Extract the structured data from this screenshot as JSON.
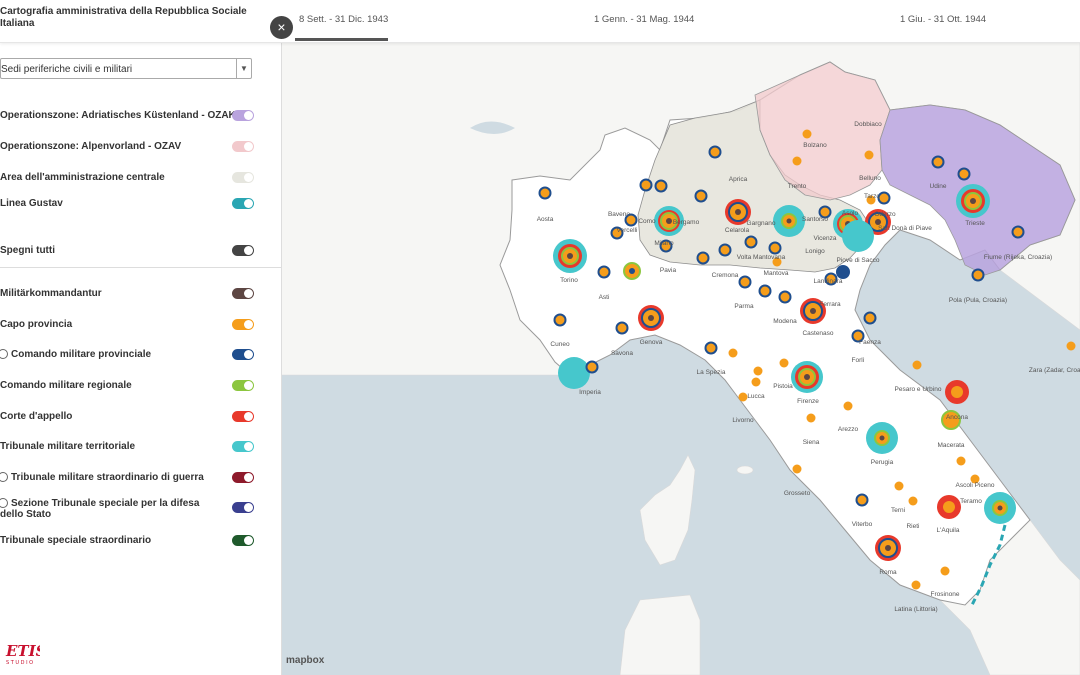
{
  "header": {
    "app_title": "Cartografia amministrativa della Repubblica Sociale Italiana",
    "tabs": [
      {
        "label": "8 Sett. - 31 Dic. 1943",
        "active": true
      },
      {
        "label": "1 Genn. - 31 Mag. 1944",
        "active": false
      },
      {
        "label": "1 Giu. - 31 Ott. 1944",
        "active": false
      }
    ]
  },
  "sidebar": {
    "select_value": "Sedi periferiche civili e militari",
    "close_icon": "close-icon",
    "area_layers": [
      {
        "label": "Operationszone: Adriatisches Küstenland - OZAK",
        "color": "#b9a3de",
        "on": true
      },
      {
        "label": "Operationszone: Alpenvorland - OZAV",
        "color": "#f2c9cc",
        "on": true
      },
      {
        "label": "Area dell'amministrazione centrale",
        "color": "#e6e6df",
        "on": true
      },
      {
        "label": "Linea Gustav",
        "color": "#2aa6b3",
        "on": true
      }
    ],
    "toggle_all_label": "Spegni tutti",
    "toggle_all_color": "#444444",
    "point_layers": [
      {
        "label": "Militärkommandantur",
        "color": "#5d4643",
        "radio": false
      },
      {
        "label": "Capo provincia",
        "color": "#f59d1b",
        "radio": false
      },
      {
        "label": "Comando militare provinciale",
        "color": "#1f4e8e",
        "radio": true
      },
      {
        "label": "Comando militare regionale",
        "color": "#8cc63f",
        "radio": false
      },
      {
        "label": "Corte d'appello",
        "color": "#e8392b",
        "radio": false
      },
      {
        "label": "Tribunale militare territoriale",
        "color": "#46c7cc",
        "radio": false
      },
      {
        "label": "Tribunale militare straordinario di guerra",
        "color": "#8e1a2b",
        "radio": true
      },
      {
        "label": "Sezione Tribunale speciale per la difesa dello Stato",
        "color": "#3a3f8f",
        "radio": true
      },
      {
        "label": "Tribunale speciale straordinario",
        "color": "#1f5a2c",
        "radio": false
      }
    ],
    "logo_text": "ETIS",
    "logo_sub": "S T U D I O"
  },
  "map": {
    "attribution": "mapbox",
    "cities": [
      {
        "name": "Aosta"
      },
      {
        "name": "Baveno"
      },
      {
        "name": "Como"
      },
      {
        "name": "Bergamo"
      },
      {
        "name": "Aprica"
      },
      {
        "name": "Bolzano"
      },
      {
        "name": "Dobbiaco"
      },
      {
        "name": "Trento"
      },
      {
        "name": "Belluno"
      },
      {
        "name": "Udine"
      },
      {
        "name": "Tarzo"
      },
      {
        "name": "Oderzo"
      },
      {
        "name": "Trieste"
      },
      {
        "name": "San Donà di Piave"
      },
      {
        "name": "Vercelli"
      },
      {
        "name": "Milano"
      },
      {
        "name": "Celarola"
      },
      {
        "name": "Gargnano"
      },
      {
        "name": "Santorso"
      },
      {
        "name": "Asolo"
      },
      {
        "name": "Vicenza"
      },
      {
        "name": "Piove di Sacco"
      },
      {
        "name": "Torino"
      },
      {
        "name": "Pavia"
      },
      {
        "name": "Volta Mantovana"
      },
      {
        "name": "Lonigo"
      },
      {
        "name": "Asti"
      },
      {
        "name": "Cremona"
      },
      {
        "name": "Mantova"
      },
      {
        "name": "Landinara"
      },
      {
        "name": "Ferrara"
      },
      {
        "name": "Fiume (Rijeka, Croazia)"
      },
      {
        "name": "Pola (Pula, Croazia)"
      },
      {
        "name": "Parma"
      },
      {
        "name": "Modena"
      },
      {
        "name": "Castenaso"
      },
      {
        "name": "Faenza"
      },
      {
        "name": "Cuneo"
      },
      {
        "name": "Savona"
      },
      {
        "name": "Genova"
      },
      {
        "name": "Forlì"
      },
      {
        "name": "La Spezia"
      },
      {
        "name": "Imperia"
      },
      {
        "name": "Lucca"
      },
      {
        "name": "Pistoia"
      },
      {
        "name": "Firenze"
      },
      {
        "name": "Pesaro e Urbino"
      },
      {
        "name": "Livorno"
      },
      {
        "name": "Zara (Zadar, Croazia)"
      },
      {
        "name": "Ancona"
      },
      {
        "name": "Arezzo"
      },
      {
        "name": "Siena"
      },
      {
        "name": "Macerata"
      },
      {
        "name": "Perugia"
      },
      {
        "name": "Ascoli Piceno"
      },
      {
        "name": "Grosseto"
      },
      {
        "name": "Teramo"
      },
      {
        "name": "Terni"
      },
      {
        "name": "Rieti"
      },
      {
        "name": "Viterbo"
      },
      {
        "name": "L'Aquila"
      },
      {
        "name": "Roma"
      },
      {
        "name": "Frosinone"
      },
      {
        "name": "Latina (Littoria)"
      }
    ]
  }
}
